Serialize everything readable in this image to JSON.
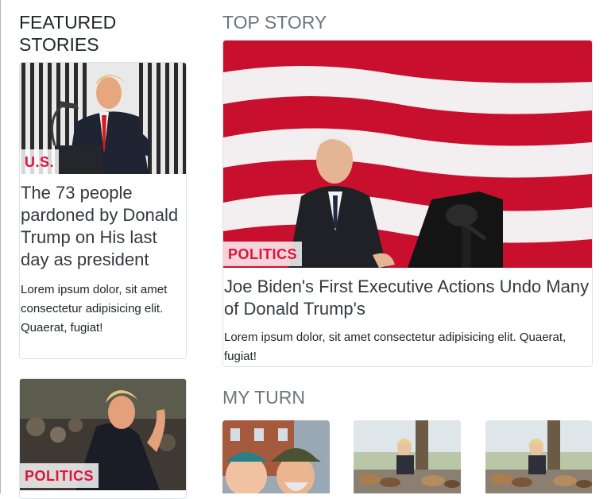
{
  "featured": {
    "title": "FEATURED STORIES",
    "cards": [
      {
        "category": "U.S.",
        "headline": "The 73 people pardoned by Donald Trump on His last day as president",
        "body": "Lorem ipsum dolor, sit amet consectetur adipisicing elit. Quaerat, fugiat!"
      },
      {
        "category": "POLITICS"
      }
    ]
  },
  "top_story": {
    "title": "TOP STORY",
    "category": "POLITICS",
    "headline": "Joe Biden's First Executive Actions Undo Many of Donald Trump's",
    "body": "Lorem ipsum dolor, sit amet consectetur adipisicing elit. Quaerat, fugiat!"
  },
  "my_turn": {
    "title": "MY TURN",
    "thumbnails": [
      "two-men-laughing-photo",
      "woman-with-dogs-photo",
      "woman-with-dogs-photo"
    ]
  },
  "colors": {
    "category_red": "#dc143c",
    "section_gray": "#6c757d",
    "flag_red": "#c8102e"
  }
}
